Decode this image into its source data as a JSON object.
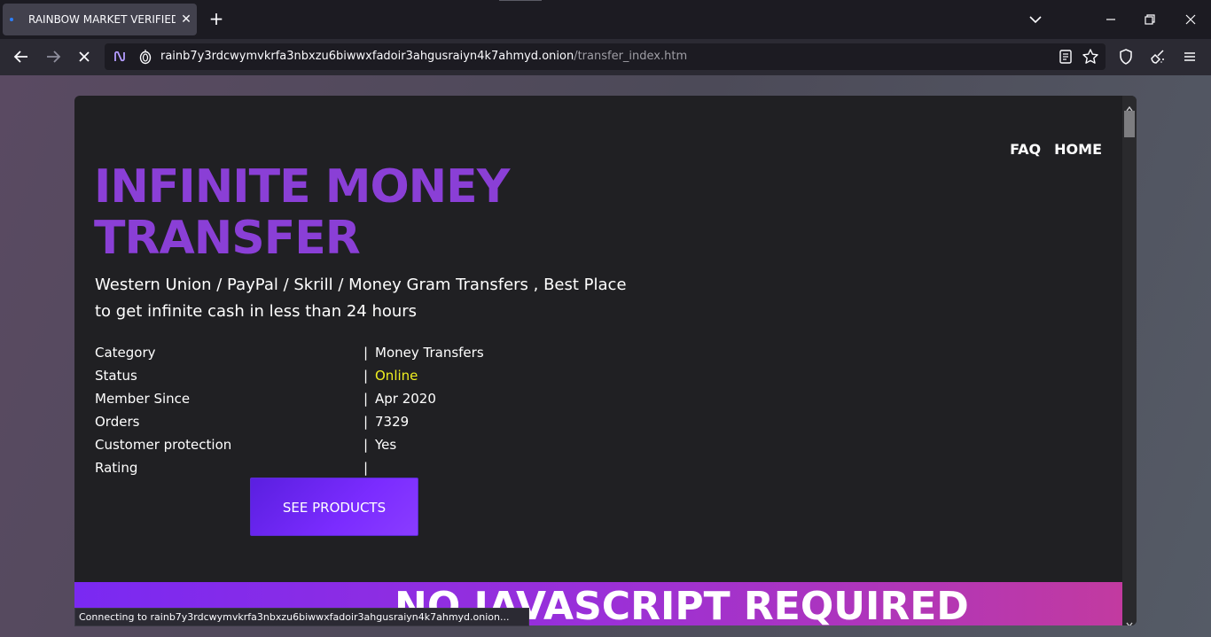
{
  "browser": {
    "tab": {
      "title": "RAINBOW MARKET VERIFIED * |",
      "close": "✕"
    },
    "new_tab": "+",
    "url": {
      "host": "rainb7y3rdcwymvkrfa3nbxzu6biwwxfadoir3ahgusraiyn4k7ahmyd.onion",
      "path": "/transfer_index.htm"
    },
    "status_text": "Connecting to rainb7y3rdcwymvkrfa3nbxzu6biwwxfadoir3ahgusraiyn4k7ahmyd.onion..."
  },
  "page": {
    "nav": {
      "faq": "FAQ",
      "home": "HOME"
    },
    "headline": "INFINITE MONEY TRANSFER",
    "tagline": "Western Union / PayPal / Skrill / Money Gram Transfers , Best Place to get infinite cash in less than 24 hours",
    "separator": "|",
    "info": [
      {
        "label": "Category",
        "value": "Money Transfers"
      },
      {
        "label": "Status",
        "value": "Online"
      },
      {
        "label": "Member Since",
        "value": "Apr 2020"
      },
      {
        "label": "Orders",
        "value": "7329"
      },
      {
        "label": "Customer protection",
        "value": "Yes"
      },
      {
        "label": "Rating",
        "value": ""
      }
    ],
    "see_products_label": "SEE PRODUCTS",
    "banner_text": "NO JAVASCRIPT REQUIRED"
  },
  "colors": {
    "headline": "#8a3fd6",
    "status_online": "#f0f020",
    "button": "#7b2cff",
    "banner_start": "#7a29f2",
    "banner_end": "#c23aa0"
  }
}
